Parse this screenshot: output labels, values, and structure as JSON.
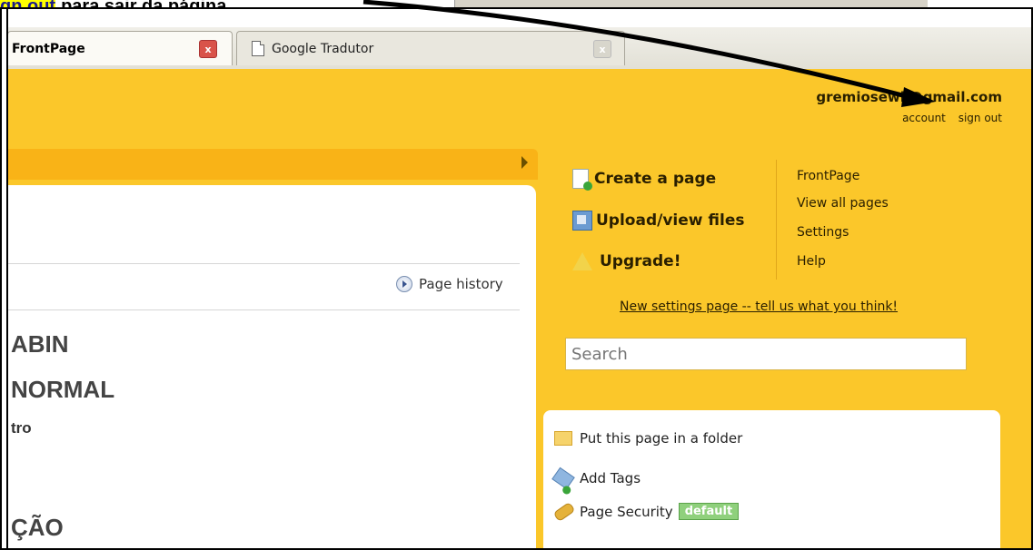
{
  "caption": {
    "highlight": "gn out",
    "rest": "para sair da página"
  },
  "tabs": [
    {
      "title": "FrontPage",
      "close": "x"
    },
    {
      "title": "Google Tradutor",
      "close": "x"
    }
  ],
  "account": {
    "email": "gremiosewk@gmail.com",
    "links": [
      "account",
      "sign out"
    ]
  },
  "left": {
    "page_history": "Page history",
    "line1": "ABIN",
    "line2": "NORMAL",
    "line3": "tro",
    "line4": "ÇÃO"
  },
  "sidebar": {
    "actions": [
      "Create a page",
      "Upload/view files",
      "Upgrade!"
    ],
    "nav": [
      "FrontPage",
      "View all pages",
      "Settings",
      "Help"
    ],
    "settings_feedback": "New settings page -- tell us what you think!",
    "search_placeholder": "Search"
  },
  "page_tools": {
    "folder": "Put this page in a folder",
    "tags": "Add Tags",
    "security": "Page Security",
    "security_badge": "default"
  },
  "colors": {
    "page_bg": "#fbc72a",
    "topbar": "#f9b317",
    "badge": "#8fd07c"
  },
  "icons": [
    "close-icon",
    "document-icon",
    "create-page-icon",
    "upload-icon",
    "upgrade-star-icon",
    "history-icon",
    "folder-icon",
    "tag-icon",
    "key-icon",
    "arrow-annotation"
  ]
}
